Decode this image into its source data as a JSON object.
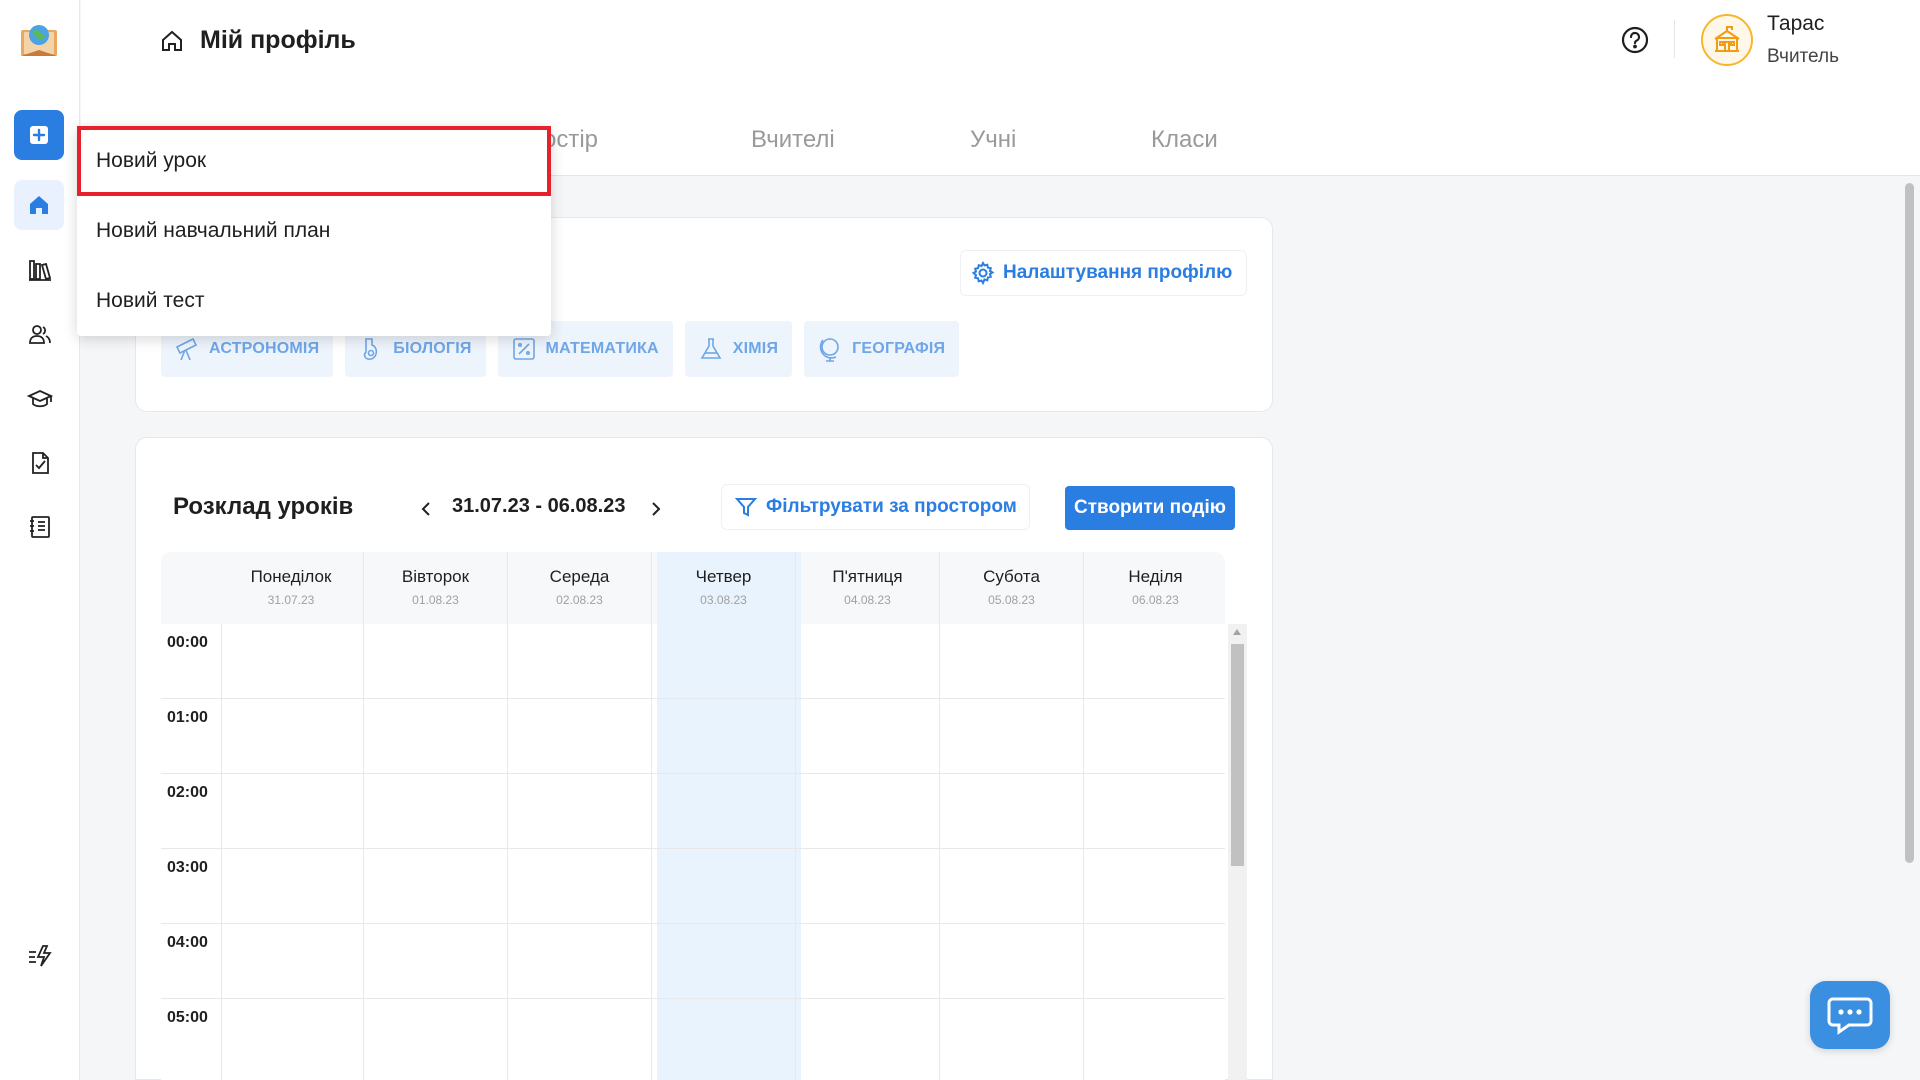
{
  "header": {
    "title": "Мій профіль",
    "user_name": "Тарас",
    "user_role": "Вчитель"
  },
  "tabs": [
    {
      "label": "остір"
    },
    {
      "label": "Вчителі"
    },
    {
      "label": "Учні"
    },
    {
      "label": "Класи"
    }
  ],
  "dropdown": {
    "items": [
      {
        "label": "Новий урок"
      },
      {
        "label": "Новий навчальний план"
      },
      {
        "label": "Новий тест"
      }
    ]
  },
  "profile": {
    "settings_label": "Налаштування профілю",
    "subjects": [
      {
        "label": "АСТРОНОМІЯ",
        "icon": "telescope-icon"
      },
      {
        "label": "БІОЛОГІЯ",
        "icon": "biology-icon"
      },
      {
        "label": "МАТЕМАТИКА",
        "icon": "math-icon"
      },
      {
        "label": "ХІМІЯ",
        "icon": "flask-icon"
      },
      {
        "label": "ГЕОГРАФІЯ",
        "icon": "globe-icon"
      }
    ]
  },
  "schedule": {
    "title": "Розклад уроків",
    "week_range": "31.07.23 - 06.08.23",
    "filter_label": "Фільтрувати за простором",
    "create_label": "Створити подію",
    "days": [
      {
        "name": "Понеділок",
        "date": "31.07.23"
      },
      {
        "name": "Вівторок",
        "date": "01.08.23"
      },
      {
        "name": "Середа",
        "date": "02.08.23"
      },
      {
        "name": "Четвер",
        "date": "03.08.23"
      },
      {
        "name": "П'ятниця",
        "date": "04.08.23"
      },
      {
        "name": "Субота",
        "date": "05.08.23"
      },
      {
        "name": "Неділя",
        "date": "06.08.23"
      }
    ],
    "hours": [
      "00:00",
      "01:00",
      "02:00",
      "03:00",
      "04:00",
      "05:00"
    ],
    "today_index": 3
  },
  "colors": {
    "accent": "#2a7de1",
    "highlight_border": "#e5212b",
    "today_bg": "#e8f3fd"
  }
}
